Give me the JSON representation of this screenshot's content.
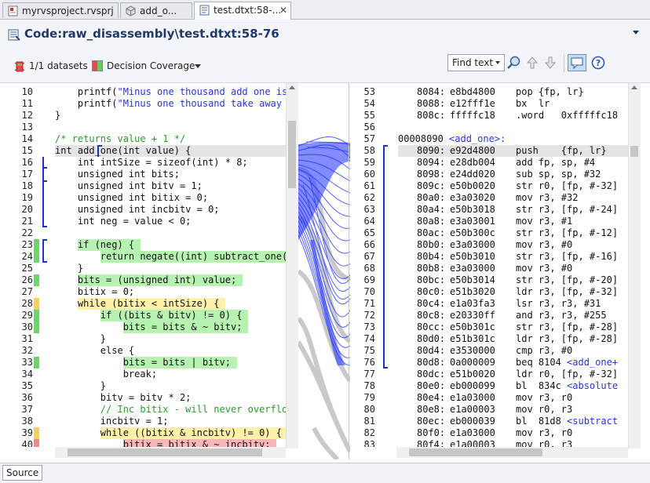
{
  "tabs": [
    {
      "label": "myrvsproject.rvsprj"
    },
    {
      "label": "add_o..."
    },
    {
      "label": "test.dtxt:58-...",
      "close": "✕"
    }
  ],
  "header": {
    "title": "Code:raw_disassembly\\test.dtxt:58-76"
  },
  "toolbar": {
    "datasets": "1/1 datasets",
    "coverage": "Decision Coverage",
    "find": "Find text"
  },
  "colors": {
    "green": "#b6f2b0",
    "yellow": "#fff1a8",
    "red": "#f7b7b7",
    "comment": "#2a9b2a",
    "string": "#2a34d6",
    "label": "#2a34d6",
    "selected": "#e4e4e4"
  },
  "source": {
    "lines": [
      {
        "n": "10",
        "text": "    printf(\"Minus one thousand add one is",
        "cov": "",
        "str": true
      },
      {
        "n": "11",
        "text": "    printf(\"Minus one thousand take away o",
        "cov": "",
        "str": true
      },
      {
        "n": "12",
        "text": "}",
        "cov": ""
      },
      {
        "n": "13",
        "text": "",
        "cov": ""
      },
      {
        "n": "14",
        "text": "/* returns value + 1 */",
        "cov": "",
        "comment": true
      },
      {
        "n": "15",
        "text": "int add_one(int value) {",
        "cov": "sel"
      },
      {
        "n": "16",
        "text": "    int intSize = sizeof(int) * 8;",
        "cov": ""
      },
      {
        "n": "17",
        "text": "    unsigned int bits;",
        "cov": ""
      },
      {
        "n": "18",
        "text": "    unsigned int bitv = 1;",
        "cov": ""
      },
      {
        "n": "19",
        "text": "    unsigned int bitix = 0;",
        "cov": ""
      },
      {
        "n": "20",
        "text": "    unsigned int incbitv = 0;",
        "cov": ""
      },
      {
        "n": "21",
        "text": "    int neg = value < 0;",
        "cov": ""
      },
      {
        "n": "22",
        "text": "",
        "cov": ""
      },
      {
        "n": "23",
        "text": "    if (neg) {",
        "cov": "green"
      },
      {
        "n": "24",
        "text": "        return negate((int) subtract_one(a",
        "cov": "green"
      },
      {
        "n": "25",
        "text": "    }",
        "cov": ""
      },
      {
        "n": "26",
        "text": "    bits = (unsigned int) value;",
        "cov": "green"
      },
      {
        "n": "27",
        "text": "    bitix = 0;",
        "cov": ""
      },
      {
        "n": "28",
        "text": "    while (bitix < intSize) {",
        "cov": "yellow"
      },
      {
        "n": "29",
        "text": "        if ((bits & bitv) != 0) {",
        "cov": "green"
      },
      {
        "n": "30",
        "text": "            bits = bits & ~ bitv;",
        "cov": "green"
      },
      {
        "n": "31",
        "text": "        }",
        "cov": ""
      },
      {
        "n": "32",
        "text": "        else {",
        "cov": ""
      },
      {
        "n": "33",
        "text": "            bits = bits | bitv;",
        "cov": "green"
      },
      {
        "n": "34",
        "text": "            break;",
        "cov": ""
      },
      {
        "n": "35",
        "text": "        }",
        "cov": ""
      },
      {
        "n": "36",
        "text": "        bitv = bitv * 2;",
        "cov": ""
      },
      {
        "n": "37",
        "text": "        // Inc bitix - will never overflow",
        "cov": "",
        "comment": true
      },
      {
        "n": "38",
        "text": "        incbitv = 1;",
        "cov": ""
      },
      {
        "n": "39",
        "text": "        while ((bitix & incbitv) != 0) {",
        "cov": "yellow"
      },
      {
        "n": "40",
        "text": "            bitix = bitix & ~ incbitv;",
        "cov": "red"
      }
    ]
  },
  "disasm": {
    "lines": [
      {
        "n": "53",
        "addr": "8084:",
        "hex": "e8bd4800",
        "ins": "pop {fp, lr}"
      },
      {
        "n": "54",
        "addr": "8088:",
        "hex": "e12fff1e",
        "ins": "bx  lr"
      },
      {
        "n": "55",
        "addr": "808c:",
        "hex": "fffffc18",
        "ins": ".word   0xfffffc18"
      },
      {
        "n": "56",
        "addr": "",
        "hex": "",
        "ins": ""
      },
      {
        "n": "57",
        "label_addr": "00008090",
        "label": "<add_one>:"
      },
      {
        "n": "58",
        "addr": "8090:",
        "hex": "e92d4800",
        "ins": "push    {fp, lr}",
        "sel": true
      },
      {
        "n": "59",
        "addr": "8094:",
        "hex": "e28db004",
        "ins": "add fp, sp, #4"
      },
      {
        "n": "60",
        "addr": "8098:",
        "hex": "e24dd020",
        "ins": "sub sp, sp, #32"
      },
      {
        "n": "61",
        "addr": "809c:",
        "hex": "e50b0020",
        "ins": "str r0, [fp, #-32]"
      },
      {
        "n": "62",
        "addr": "80a0:",
        "hex": "e3a03020",
        "ins": "mov r3, #32"
      },
      {
        "n": "63",
        "addr": "80a4:",
        "hex": "e50b3018",
        "ins": "str r3, [fp, #-24]"
      },
      {
        "n": "64",
        "addr": "80a8:",
        "hex": "e3a03001",
        "ins": "mov r3, #1"
      },
      {
        "n": "65",
        "addr": "80ac:",
        "hex": "e50b300c",
        "ins": "str r3, [fp, #-12]"
      },
      {
        "n": "66",
        "addr": "80b0:",
        "hex": "e3a03000",
        "ins": "mov r3, #0"
      },
      {
        "n": "67",
        "addr": "80b4:",
        "hex": "e50b3010",
        "ins": "str r3, [fp, #-16]"
      },
      {
        "n": "68",
        "addr": "80b8:",
        "hex": "e3a03000",
        "ins": "mov r3, #0"
      },
      {
        "n": "69",
        "addr": "80bc:",
        "hex": "e50b3014",
        "ins": "str r3, [fp, #-20]"
      },
      {
        "n": "70",
        "addr": "80c0:",
        "hex": "e51b3020",
        "ins": "ldr r3, [fp, #-32]"
      },
      {
        "n": "71",
        "addr": "80c4:",
        "hex": "e1a03fa3",
        "ins": "lsr r3, r3, #31"
      },
      {
        "n": "72",
        "addr": "80c8:",
        "hex": "e20330ff",
        "ins": "and r3, r3, #255"
      },
      {
        "n": "73",
        "addr": "80cc:",
        "hex": "e50b301c",
        "ins": "str r3, [fp, #-28]"
      },
      {
        "n": "74",
        "addr": "80d0:",
        "hex": "e51b301c",
        "ins": "ldr r3, [fp, #-28]"
      },
      {
        "n": "75",
        "addr": "80d4:",
        "hex": "e3530000",
        "ins": "cmp r3, #0"
      },
      {
        "n": "76",
        "addr": "80d8:",
        "hex": "0a000009",
        "ins": "beq 8104",
        "lbl": "<add_one+"
      },
      {
        "n": "77",
        "addr": "80dc:",
        "hex": "e51b0020",
        "ins": "ldr r0, [fp, #-32]"
      },
      {
        "n": "78",
        "addr": "80e0:",
        "hex": "eb000099",
        "ins": "bl  834c",
        "lbl": "<absolute"
      },
      {
        "n": "79",
        "addr": "80e4:",
        "hex": "e1a03000",
        "ins": "mov r3, r0"
      },
      {
        "n": "80",
        "addr": "80e8:",
        "hex": "e1a00003",
        "ins": "mov r0, r3"
      },
      {
        "n": "81",
        "addr": "80ec:",
        "hex": "eb000039",
        "ins": "bl  81d8",
        "lbl": "<subtract"
      },
      {
        "n": "82",
        "addr": "80f0:",
        "hex": "e1a03000",
        "ins": "mov r3, r0"
      },
      {
        "n": "83",
        "addr": "80f4:",
        "hex": "e1a00003",
        "ins": "mov r0, r3"
      }
    ]
  },
  "bottom": {
    "source_tab": "Source"
  }
}
